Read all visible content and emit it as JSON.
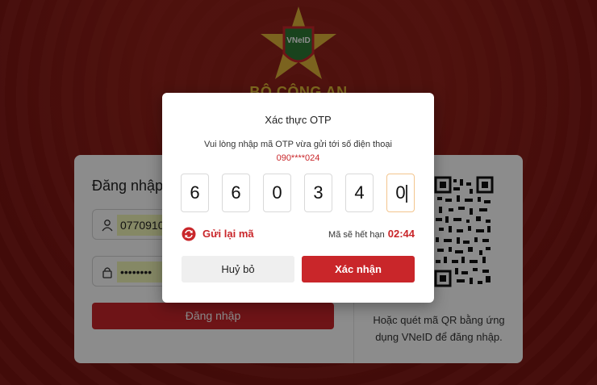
{
  "brand": {
    "org_name": "BỘ CÔNG AN",
    "logo_text": "VNeID"
  },
  "login": {
    "title": "Đăng nhập",
    "username_value": "0770910",
    "password_mask": "••••••••",
    "submit_label": "Đăng nhập",
    "qr_hint": "Hoặc quét mã QR bằng ứng dụng VNeID để đăng nhập."
  },
  "otp_modal": {
    "title": "Xác thực OTP",
    "description": "Vui lòng nhập mã OTP vừa gửi tới số điện thoại",
    "phone_masked": "090****024",
    "digits": [
      "6",
      "6",
      "0",
      "3",
      "4",
      "0"
    ],
    "resend_label": "Gửi lại mã",
    "expiry_label": "Mã sẽ hết hạn",
    "expiry_timer": "02:44",
    "cancel_label": "Huỷ bỏ",
    "confirm_label": "Xác nhận"
  },
  "icons": [
    "emblem-icon",
    "user-icon",
    "lock-icon",
    "qr-code-icon",
    "refresh-icon"
  ],
  "colors": {
    "brand_red": "#c9262a",
    "background_red": "#7d1512",
    "emblem_gold": "#e8c23a"
  }
}
